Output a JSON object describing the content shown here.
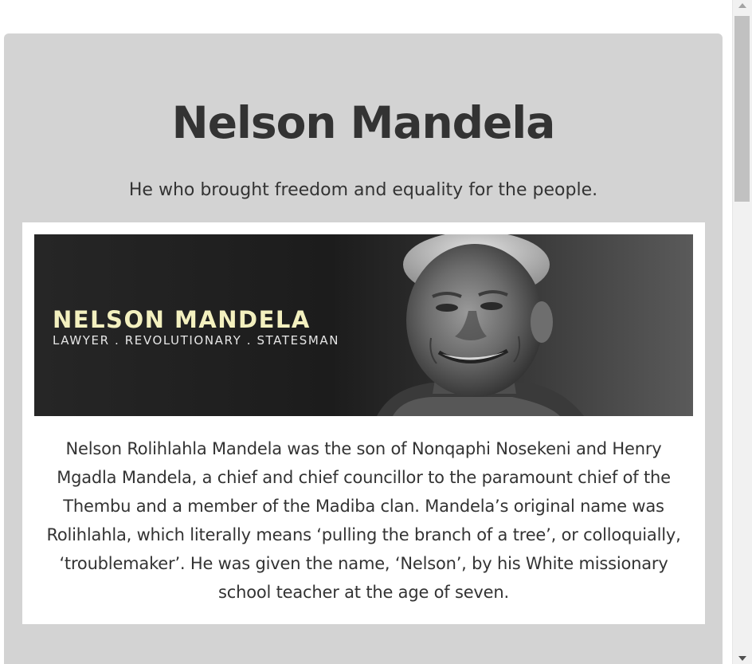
{
  "page": {
    "title": "Nelson Mandela",
    "subtitle": "He who brought freedom and equality for the people."
  },
  "banner": {
    "name": "NELSON MANDELA",
    "tagline": "LAWYER . REVOLUTIONARY . STATESMAN",
    "image_description": "black-and-white-portrait"
  },
  "bio": {
    "text": "Nelson Rolihlahla Mandela was the son of Nonqaphi Nosekeni and Henry Mgadla Mandela, a chief and chief councillor to the paramount chief of the Thembu and a member of the Madiba clan. Mandela’s original name was Rolihlahla, which literally means ‘pulling the branch of a tree’, or colloquially, ‘troublemaker’. He was given the name, ‘Nelson’, by his White missionary school teacher at the age of seven."
  },
  "colors": {
    "jumbotron_background": "#d3d3d3",
    "card_background": "#ffffff",
    "text": "#333333",
    "banner_name": "#f3f0bf"
  },
  "scrollbar": {
    "up_icon": "scroll-up-arrow-icon",
    "down_icon": "scroll-down-arrow-icon"
  }
}
